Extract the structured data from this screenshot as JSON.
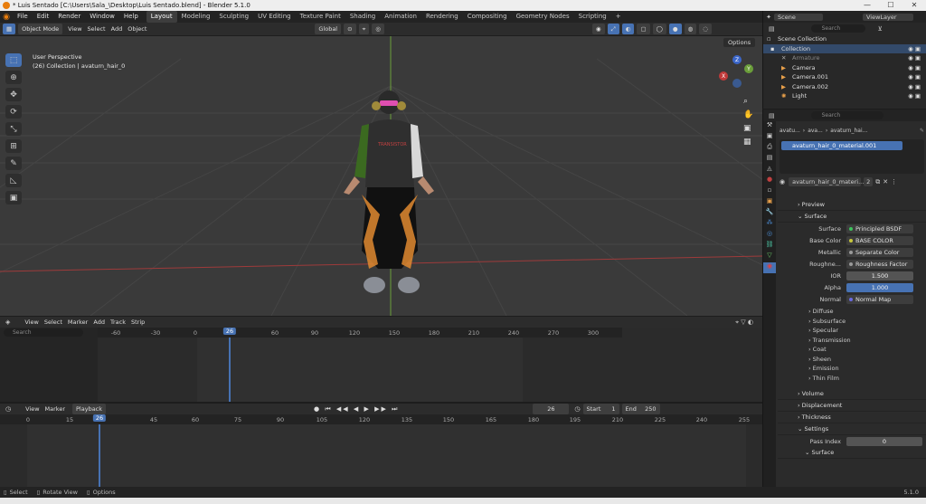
{
  "window": {
    "title": "* Luis Sentado [C:\\Users\\Sala_\\Desktop\\Luis Sentado.blend] - Blender 5.1.0",
    "controls": [
      "—",
      "☐",
      "✕"
    ]
  },
  "menu": [
    "File",
    "Edit",
    "Render",
    "Window",
    "Help"
  ],
  "workspaces": [
    "Layout",
    "Modeling",
    "Sculpting",
    "UV Editing",
    "Texture Paint",
    "Shading",
    "Animation",
    "Rendering",
    "Compositing",
    "Geometry Nodes",
    "Scripting"
  ],
  "workspace_add": "+",
  "scene": "Scene",
  "view_layer": "ViewLayer",
  "viewport": {
    "mode": "Object Mode",
    "menus": [
      "View",
      "Select",
      "Add",
      "Object"
    ],
    "orientation": "Global",
    "options": "Options",
    "overlay_title": "User Perspective",
    "overlay_sub": "(26) Collection | avaturn_hair_0",
    "gizmo": {
      "z": "Z",
      "y": "Y",
      "x": "X"
    }
  },
  "outliner": {
    "search_placeholder": "Search",
    "items": [
      {
        "label": "Scene Collection"
      },
      {
        "label": "Collection"
      },
      {
        "label": "Armature"
      },
      {
        "label": "Camera"
      },
      {
        "label": "Camera.001"
      },
      {
        "label": "Camera.002"
      },
      {
        "label": "Light"
      }
    ]
  },
  "properties": {
    "search_placeholder": "Search",
    "breadcrumb": [
      "avatu...",
      "ava...",
      "avaturn_hai..."
    ],
    "material_slot": "avaturn_hair_0_material.001",
    "material_name": "avaturn_hair_0_materi...",
    "user_count": "2",
    "preview": "Preview",
    "surface_panel": "Surface",
    "surface_label": "Surface",
    "surface_value": "Principled BSDF",
    "rows": [
      {
        "label": "Base Color",
        "value": "BASE COLOR",
        "dot": "#c8c83c",
        "kind": "field"
      },
      {
        "label": "Metallic",
        "value": "Separate Color",
        "dot": "#6b9e45",
        "kind": "field"
      },
      {
        "label": "Roughne...",
        "value": "Roughness Factor",
        "dot": "#9a9a9a",
        "kind": "field"
      },
      {
        "label": "IOR",
        "value": "1.500",
        "kind": "num"
      },
      {
        "label": "Alpha",
        "value": "1.000",
        "kind": "numblue"
      },
      {
        "label": "Normal",
        "value": "Normal Map",
        "dot": "#6a6ae0",
        "kind": "field"
      }
    ],
    "subpanels": [
      "Diffuse",
      "Subsurface",
      "Specular",
      "Transmission",
      "Coat",
      "Sheen",
      "Emission",
      "Thin Film"
    ],
    "sections": [
      "Volume",
      "Displacement",
      "Thickness",
      "Settings"
    ],
    "pass_index_label": "Pass Index",
    "pass_index_value": "0",
    "settings_sub": "Surface"
  },
  "dopesheet": {
    "menus": [
      "View",
      "Select",
      "Marker",
      "Add",
      "Track",
      "Strip"
    ],
    "search_placeholder": "Search",
    "ticks": [
      "-60",
      "-30",
      "0",
      "26",
      "60",
      "90",
      "120",
      "150",
      "180",
      "210",
      "240",
      "270",
      "300"
    ]
  },
  "timeline": {
    "menus": [
      "View",
      "Marker"
    ],
    "playback": "Playback",
    "current_frame": "26",
    "start_label": "Start",
    "start": "1",
    "end_label": "End",
    "end": "250",
    "ticks": [
      "0",
      "15",
      "26",
      "45",
      "60",
      "75",
      "90",
      "105",
      "120",
      "135",
      "150",
      "165",
      "180",
      "195",
      "210",
      "225",
      "240",
      "255"
    ]
  },
  "statusbar": {
    "items": [
      "Select",
      "Rotate View",
      "Options"
    ],
    "version": "5.1.0"
  },
  "colors": {
    "accent": "#4772b3",
    "playhead": "#4772b3",
    "x_axis": "#9e3a3a",
    "y_axis": "#6b9e3a"
  }
}
